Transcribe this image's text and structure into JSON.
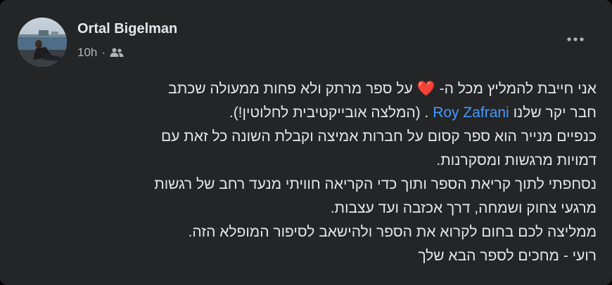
{
  "post": {
    "author_name": "Ortal Bigelman",
    "timestamp": "10h",
    "separator": "·",
    "audience_icon": "friends-icon",
    "more_icon": "more-dots-icon",
    "avatar_icon": "profile-photo-avatar",
    "colors": {
      "background": "#242526",
      "text": "#e4e6eb",
      "secondary_text": "#b0b3b8",
      "link": "#4599ff",
      "heart": "#f0284a"
    },
    "body": {
      "line1_a": "אני חייבת להמליץ מכל ה-",
      "heart_emoji": "❤️",
      "line1_b": "על ספר מרתק ולא פחות ממעולה שכתב",
      "line2_a": "חבר יקר שלנו",
      "mention": "Roy Zafrani",
      "line2_b": ". (המלצה אובייקטיבית לחלוטין!).",
      "line3": "כנפיים מנייר הוא ספר קסום על חברות אמיצה וקבלת השונה כל זאת עם",
      "line4": "דמויות מרגשות ומסקרנות.",
      "line5": "נסחפתי לתוך קריאת הספר ותוך כדי הקריאה חוויתי מנעד רחב של רגשות",
      "line6": "מרגעי צחוק ושמחה, דרך אכזבה ועד עצבות.",
      "line7": "ממליצה לכם בחום לקרוא את הספר ולהישאב לסיפור המופלא הזה.",
      "line8": "רועי - מחכים לספר הבא שלך"
    }
  }
}
